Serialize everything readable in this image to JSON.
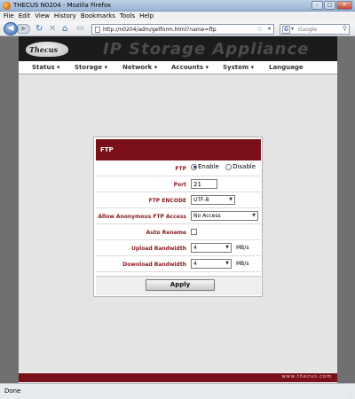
{
  "window": {
    "title": "THECUS N0204 - Mozilla Firefox",
    "minimize": "–",
    "maximize": "□",
    "close": "✕"
  },
  "menubar": [
    "File",
    "Edit",
    "View",
    "History",
    "Bookmarks",
    "Tools",
    "Help"
  ],
  "navbar": {
    "url": "http://n0204/adm/getform.html?name=ftp",
    "search_placeholder": "Google",
    "search_engine_letter": "G",
    "icons": [
      "back-icon",
      "forward-icon",
      "reload-icon",
      "stop-icon",
      "home-icon",
      "bookmark-star-icon",
      "search-icon"
    ]
  },
  "header": {
    "logo": "Thecus",
    "title": "IP Storage Appliance"
  },
  "mainnav": [
    "Status",
    "Storage",
    "Network",
    "Accounts",
    "System",
    "Language"
  ],
  "ftp": {
    "title": "FTP",
    "rows": {
      "ftp_label": "FTP",
      "enable_label": "Enable",
      "disable_label": "Disable",
      "ftp_selected": "Enable",
      "port_label": "Port",
      "port_value": "21",
      "encode_label": "FTP ENCODE",
      "encode_value": "UTF-8",
      "anon_label": "Allow Anonymous FTP Access",
      "anon_value": "No Access",
      "autorename_label": "Auto Rename",
      "autorename_checked": false,
      "upload_label": "Upload Bandwidth",
      "upload_value": "4",
      "upload_unit": "MB/s",
      "download_label": "Download Bandwidth",
      "download_value": "4",
      "download_unit": "MB/s"
    },
    "apply_label": "Apply"
  },
  "footer": {
    "url": "www.thecus.com"
  },
  "status": {
    "text": "Done"
  },
  "colors": {
    "accent": "#7b1118",
    "label": "#8a1a1f"
  }
}
